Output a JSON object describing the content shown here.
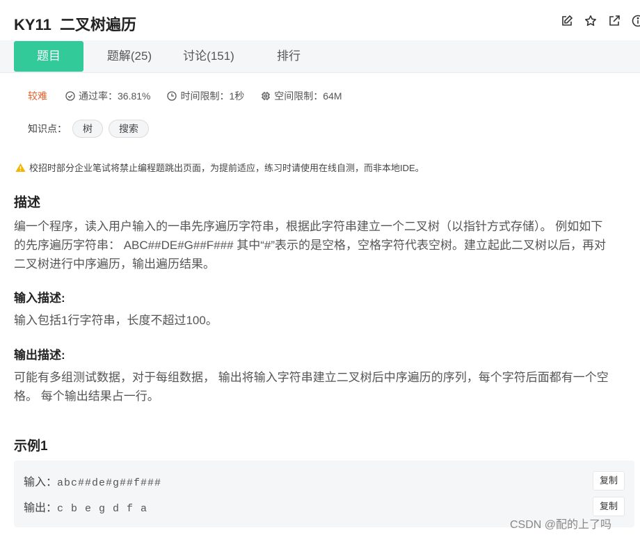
{
  "header": {
    "title": "KY11  二叉树遍历",
    "icons": [
      "edit-icon",
      "star-icon",
      "external-link-icon",
      "info-icon"
    ]
  },
  "tabs": [
    {
      "label": "题目",
      "active": true
    },
    {
      "label": "题解(25)",
      "active": false
    },
    {
      "label": "讨论(151)",
      "active": false
    },
    {
      "label": "排行",
      "active": false
    }
  ],
  "meta": {
    "difficulty": "较难",
    "pass_rate": "通过率：36.81%",
    "time_limit": "时间限制：1秒",
    "space_limit": "空间限制：64M"
  },
  "knowledge": {
    "label": "知识点：",
    "tags": [
      "树",
      "搜索"
    ]
  },
  "warning": "校招时部分企业笔试将禁止编程题跳出页面，为提前适应，练习时请使用在线自测，而非本地IDE。",
  "description": {
    "heading": "描述",
    "line1": "编一个程序，读入用户输入的一串先序遍历字符串，根据此字符串建立一个二叉树（以指针方式存储）。 例如如下",
    "line2": "的先序遍历字符串： ABC##DE#G##F### 其中“#”表示的是空格，空格字符代表空树。建立起此二叉树以后，再对",
    "line3": "二叉树进行中序遍历，输出遍历结果。"
  },
  "input_desc": {
    "heading": "输入描述:",
    "text": "输入包括1行字符串，长度不超过100。"
  },
  "output_desc": {
    "heading": "输出描述:",
    "line1": "可能有多组测试数据，对于每组数据， 输出将输入字符串建立二叉树后中序遍历的序列，每个字符后面都有一个空",
    "line2": "格。 每个输出结果占一行。"
  },
  "example": {
    "heading": "示例1",
    "input_label": "输入：",
    "input_value": "abc##de#g##f###",
    "output_label": "输出：",
    "output_value": "c b e g d f a",
    "copy_label": "复制"
  },
  "watermark": "CSDN @配的上了吗",
  "colors": {
    "accent": "#32ca99",
    "difficulty": "#e0622a",
    "warning": "#f5b400"
  }
}
